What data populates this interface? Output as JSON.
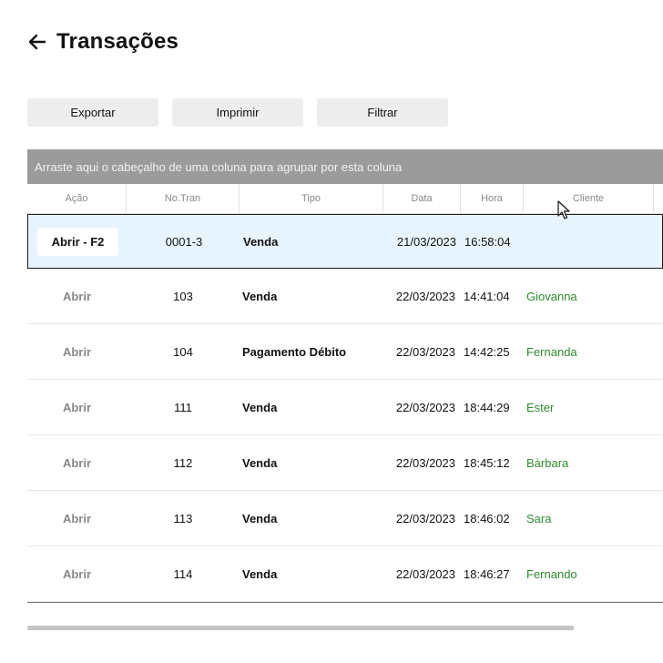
{
  "header": {
    "title": "Transações"
  },
  "toolbar": {
    "export_label": "Exportar",
    "print_label": "Imprimir",
    "filter_label": "Filtrar"
  },
  "grid": {
    "group_panel_text": "Arraste aqui o cabeçalho de uma coluna para agrupar por esta coluna",
    "columns": [
      "Ação",
      "No.Tran",
      "Tipo",
      "Data",
      "Hora",
      "Cliente"
    ],
    "rows": [
      {
        "action": "Abrir - F2",
        "no": "0001-3",
        "tipo": "Venda",
        "data": "21/03/2023",
        "hora": "16:58:04",
        "cliente": ""
      },
      {
        "action": "Abrir",
        "no": "103",
        "tipo": "Venda",
        "data": "22/03/2023",
        "hora": "14:41:04",
        "cliente": "Giovanna"
      },
      {
        "action": "Abrir",
        "no": "104",
        "tipo": "Pagamento Débito",
        "data": "22/03/2023",
        "hora": "14:42:25",
        "cliente": "Fernanda"
      },
      {
        "action": "Abrir",
        "no": "111",
        "tipo": "Venda",
        "data": "22/03/2023",
        "hora": "18:44:29",
        "cliente": "Ester"
      },
      {
        "action": "Abrir",
        "no": "112",
        "tipo": "Venda",
        "data": "22/03/2023",
        "hora": "18:45:12",
        "cliente": "Bárbara"
      },
      {
        "action": "Abrir",
        "no": "113",
        "tipo": "Venda",
        "data": "22/03/2023",
        "hora": "18:46:02",
        "cliente": "Sara"
      },
      {
        "action": "Abrir",
        "no": "114",
        "tipo": "Venda",
        "data": "22/03/2023",
        "hora": "18:46:27",
        "cliente": "Fernando"
      }
    ]
  },
  "icons": {
    "back": "arrow-left-icon",
    "cursor": "mouse-pointer-icon"
  },
  "colors": {
    "selected_row": "#e8f4fd",
    "client_text": "#2e8b2e",
    "group_panel": "#9b9b9b",
    "button_bg": "#ededed"
  }
}
